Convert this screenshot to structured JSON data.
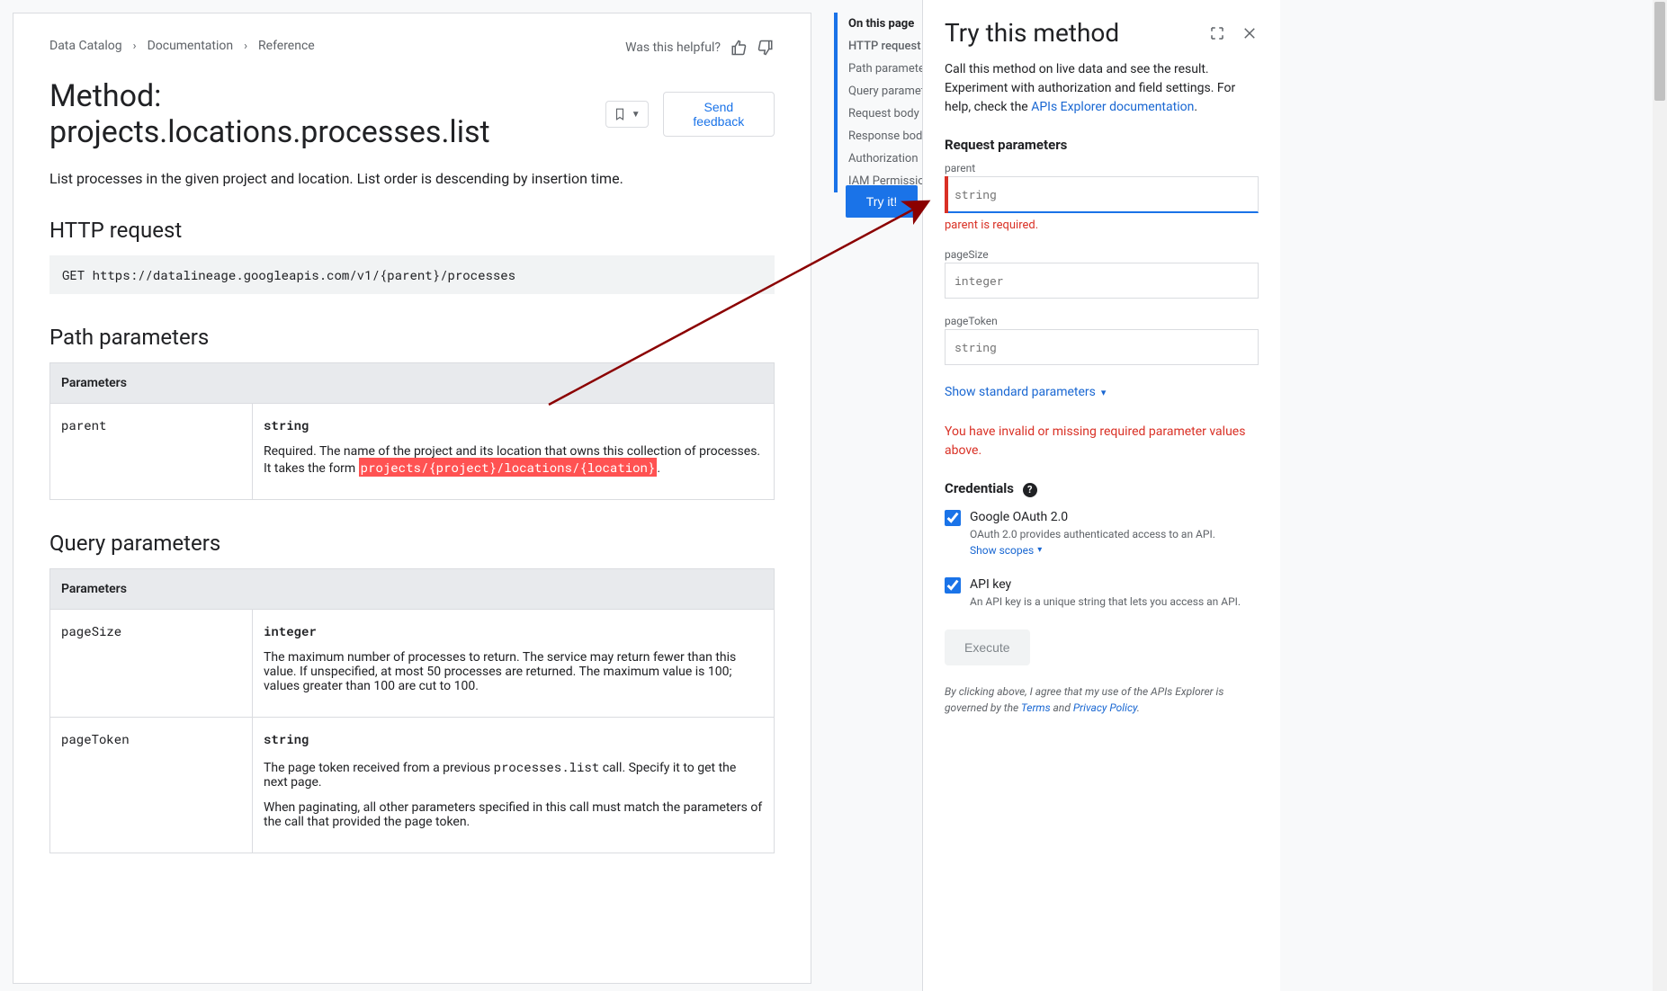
{
  "breadcrumbs": [
    "Data Catalog",
    "Documentation",
    "Reference"
  ],
  "helpful_label": "Was this helpful?",
  "title": "Method: projects.locations.processes.list",
  "send_feedback": "Send feedback",
  "lead": "List processes in the given project and location. List order is descending by insertion time.",
  "http": {
    "heading": "HTTP request",
    "request": "GET https://datalineage.googleapis.com/v1/{parent}/processes"
  },
  "path_params": {
    "heading": "Path parameters",
    "col_header": "Parameters",
    "rows": [
      {
        "name": "parent",
        "type": "string",
        "desc_pre": "Required. The name of the project and its location that owns this collection of processes. It takes the form ",
        "code": "projects/{project}/locations/{location}",
        "desc_post": "."
      }
    ]
  },
  "query_params": {
    "heading": "Query parameters",
    "col_header": "Parameters",
    "rows": [
      {
        "name": "pageSize",
        "type": "integer",
        "desc1": "The maximum number of processes to return. The service may return fewer than this value. If unspecified, at most 50 processes are returned. The maximum value is 100; values greater than 100 are cut to 100."
      },
      {
        "name": "pageToken",
        "type": "string",
        "desc1_pre": "The page token received from a previous ",
        "desc1_code": "processes.list",
        "desc1_post": " call. Specify it to get the next page.",
        "desc2": "When paginating, all other parameters specified in this call must match the parameters of the call that provided the page token."
      }
    ]
  },
  "toc": {
    "heading": "On this page",
    "items": [
      "HTTP request",
      "Path parameters",
      "Query parameters",
      "Request body",
      "Response body",
      "Authorization",
      "IAM Permissions"
    ],
    "active_index": 0,
    "try_label": "Try it!"
  },
  "panel": {
    "title": "Try this method",
    "intro_1": "Call this method on live data and see the result. Experiment with authorization and field settings. For help, check the ",
    "intro_link": "APIs Explorer documentation",
    "intro_2": ".",
    "req_params_heading": "Request parameters",
    "fields": {
      "parent": {
        "label": "parent",
        "placeholder": "string",
        "error": "parent is required."
      },
      "pageSize": {
        "label": "pageSize",
        "placeholder": "integer"
      },
      "pageToken": {
        "label": "pageToken",
        "placeholder": "string"
      }
    },
    "show_std": "Show standard parameters",
    "invalid_msg": "You have invalid or missing required parameter values above.",
    "credentials_heading": "Credentials",
    "oauth": {
      "label": "Google OAuth 2.0",
      "sub": "OAuth 2.0 provides authenticated access to an API.",
      "scopes": "Show scopes"
    },
    "apikey": {
      "label": "API key",
      "sub": "An API key is a unique string that lets you access an API."
    },
    "execute": "Execute",
    "legal_1": "By clicking above, I agree that my use of the APIs Explorer is governed by the ",
    "legal_terms": "Terms",
    "legal_and": " and ",
    "legal_pp": "Privacy Policy",
    "legal_2": "."
  }
}
